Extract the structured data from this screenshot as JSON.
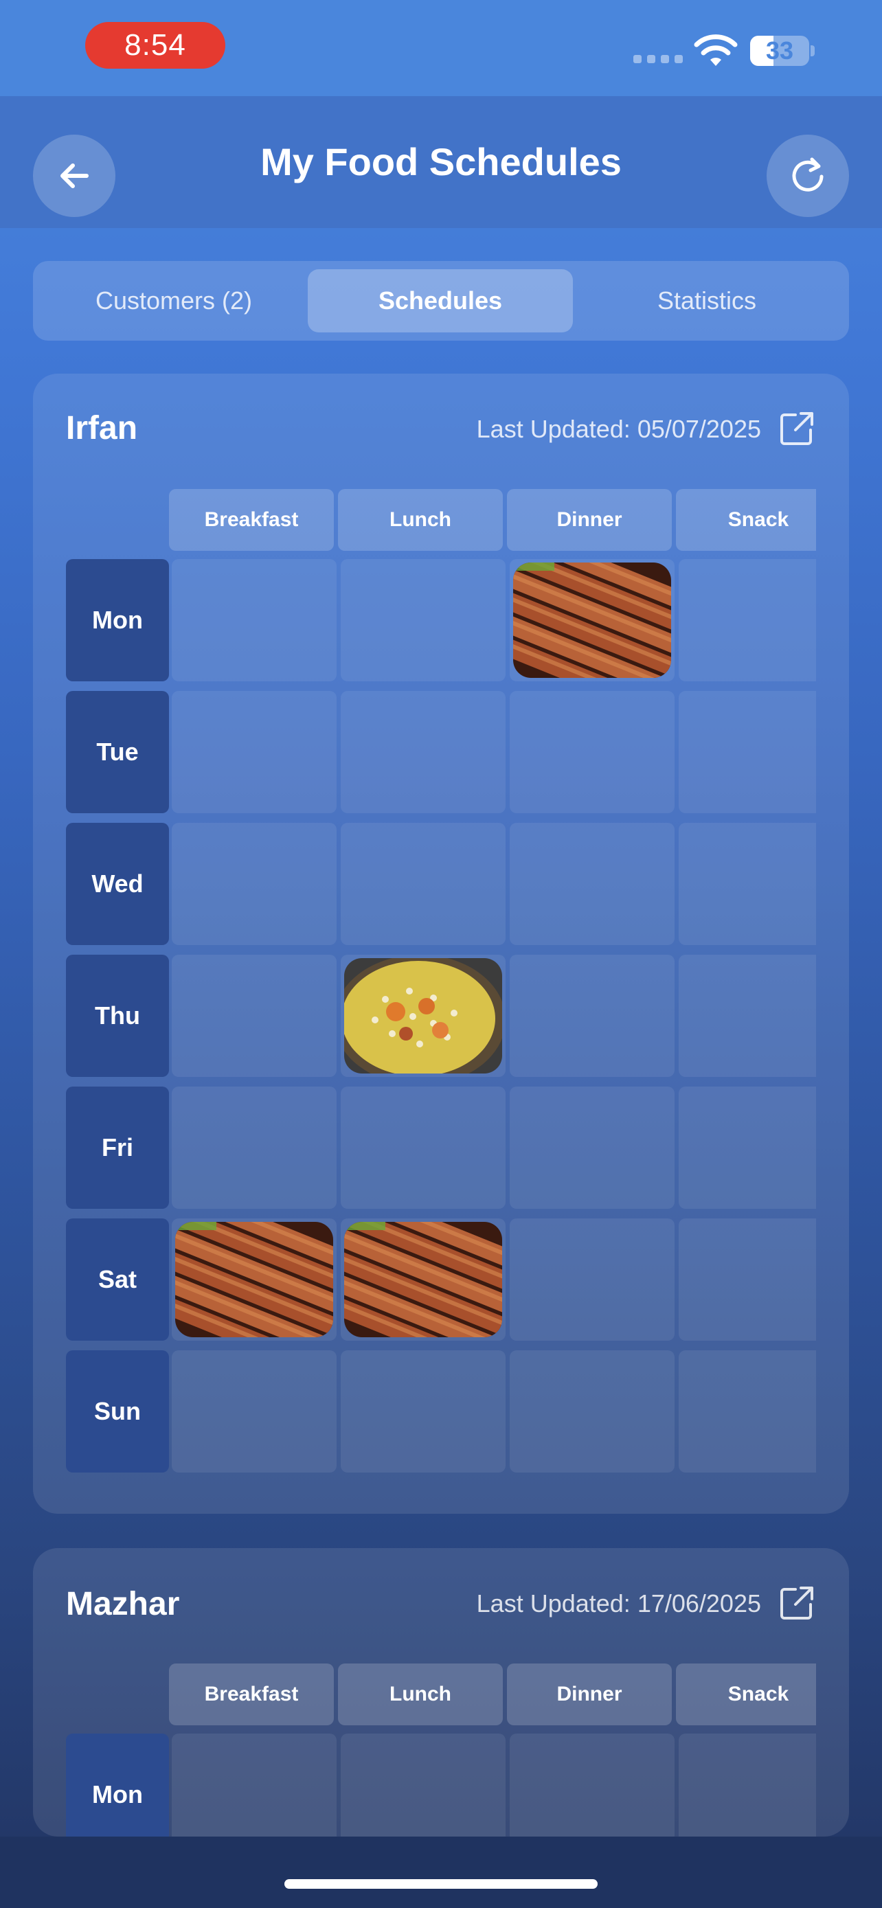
{
  "status_bar": {
    "time": "8:54",
    "battery": "33"
  },
  "header": {
    "title": "My Food Schedules",
    "back_icon": "arrow-left-icon",
    "refresh_icon": "refresh-icon"
  },
  "tabs": [
    {
      "label": "Customers (2)",
      "active": false
    },
    {
      "label": "Schedules",
      "active": true
    },
    {
      "label": "Statistics",
      "active": false
    }
  ],
  "meal_columns": [
    "Breakfast",
    "Lunch",
    "Dinner",
    "Snack"
  ],
  "days": [
    "Mon",
    "Tue",
    "Wed",
    "Thu",
    "Fri",
    "Sat",
    "Sun"
  ],
  "schedules": [
    {
      "customer": "Irfan",
      "last_updated": "Last Updated: 05/07/2025",
      "meals": [
        {
          "day": "Mon",
          "meal": "Dinner",
          "food": "kebab"
        },
        {
          "day": "Thu",
          "meal": "Lunch",
          "food": "biryani"
        },
        {
          "day": "Sat",
          "meal": "Breakfast",
          "food": "kebab"
        },
        {
          "day": "Sat",
          "meal": "Lunch",
          "food": "kebab"
        }
      ]
    },
    {
      "customer": "Mazhar",
      "last_updated": "Last Updated: 17/06/2025",
      "meals": []
    }
  ]
}
